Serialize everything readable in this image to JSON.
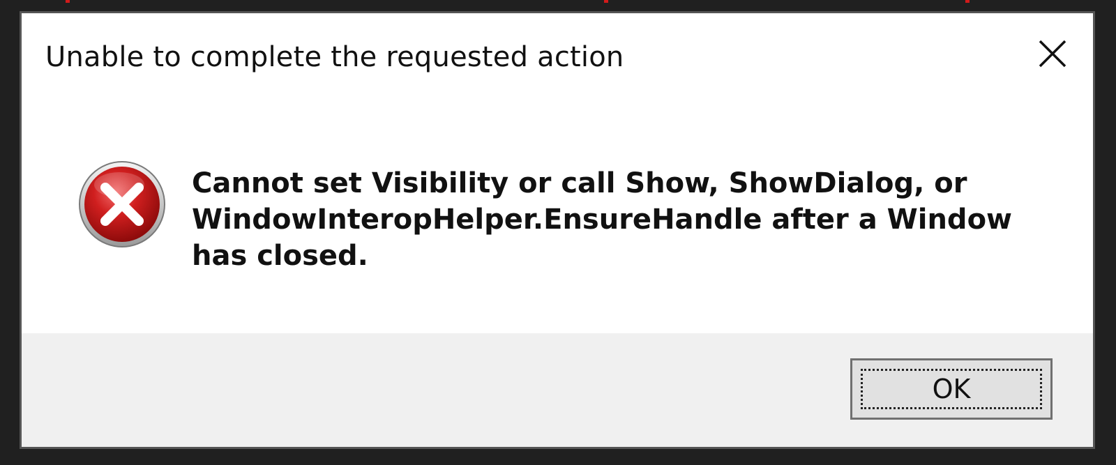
{
  "dialog": {
    "title": "Unable to complete the requested action",
    "close_icon": "close-icon",
    "error_icon": "error-icon",
    "message": "Cannot set Visibility or call Show, ShowDialog, or WindowInteropHelper.EnsureHandle after a Window has closed.",
    "ok_label": "OK"
  },
  "colors": {
    "error_red": "#cc1a1a",
    "footer_bg": "#f0f0f0",
    "button_bg": "#e1e1e1",
    "frame_border": "#555555"
  }
}
